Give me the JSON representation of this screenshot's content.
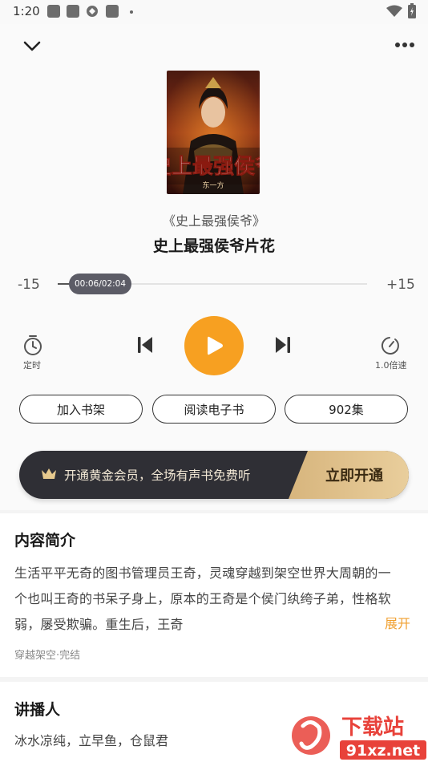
{
  "status_bar": {
    "time": "1:20",
    "icons": [
      "notification-icon",
      "notification-icon",
      "sync-icon",
      "notification-icon",
      "wifi-icon",
      "battery-icon"
    ]
  },
  "header": {
    "collapse_icon": "chevron-down-icon",
    "more_icon": "more-dots-icon"
  },
  "book": {
    "cover_title": "史上最强侯爷",
    "cover_author": "东一方",
    "book_name": "《史上最强侯爷》",
    "track_title": "史上最强侯爷片花"
  },
  "progress": {
    "seek_back": "-15",
    "seek_forward": "+15",
    "time_label": "00:06/02:04",
    "fraction": 0.05
  },
  "controls": {
    "timer_label": "定时",
    "speed_label": "1.0倍速",
    "prev_icon": "skip-previous-icon",
    "play_icon": "play-icon",
    "next_icon": "skip-next-icon",
    "accent": "#f7a021"
  },
  "actions": {
    "shelf": "加入书架",
    "read": "阅读电子书",
    "episodes": "902集"
  },
  "vip": {
    "text": "开通黄金会员，全场有声书免费听",
    "cta": "立即开通"
  },
  "intro": {
    "title": "内容简介",
    "line1": "生活平平无奇的图书管理员王奇，灵魂穿越到架空世界大周朝的一",
    "line2": "个也叫王奇的书呆子身上，原本的王奇是个侯门纨绔子弟，性格软",
    "line3": "弱，屡受欺骗。重生后，王奇",
    "expand": "展开",
    "tags": "穿越架空·完结"
  },
  "narrator": {
    "title": "讲播人",
    "names": "冰水凉纯，立早鱼，仓鼠君"
  },
  "watermark": {
    "brand": "下载站",
    "url": "91xz.net"
  }
}
